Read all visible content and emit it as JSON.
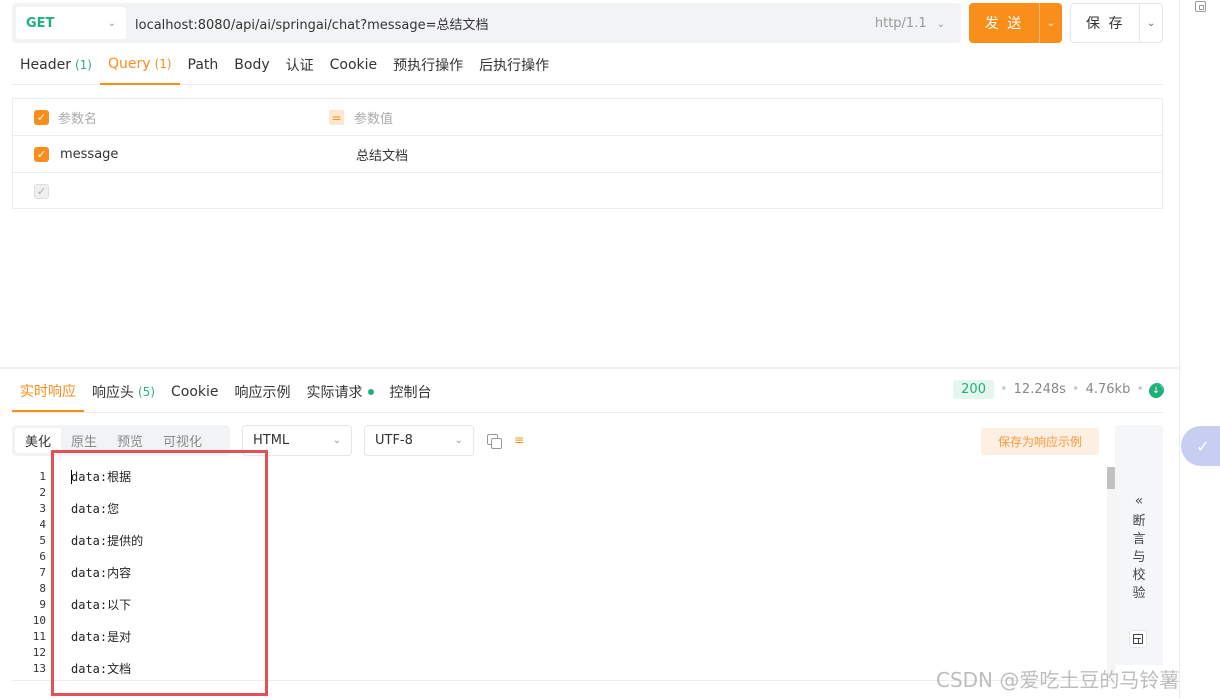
{
  "request": {
    "method": "GET",
    "url": "localhost:8080/api/ai/springai/chat?message=总结文档",
    "protocol": "http/1.1",
    "send_label": "发 送",
    "save_label": "保 存"
  },
  "request_tabs": [
    {
      "label": "Header",
      "count": "(1)"
    },
    {
      "label": "Query",
      "count": "(1)",
      "active": true
    },
    {
      "label": "Path"
    },
    {
      "label": "Body"
    },
    {
      "label": "认证"
    },
    {
      "label": "Cookie"
    },
    {
      "label": "预执行操作"
    },
    {
      "label": "后执行操作"
    }
  ],
  "params": {
    "name_placeholder": "参数名",
    "value_placeholder": "参数值",
    "rows": [
      {
        "name": "message",
        "value": "总结文档",
        "checked": true
      }
    ]
  },
  "response_tabs": [
    {
      "label": "实时响应",
      "active": true
    },
    {
      "label": "响应头",
      "count": "(5)"
    },
    {
      "label": "Cookie"
    },
    {
      "label": "响应示例"
    },
    {
      "label": "实际请求",
      "dot": true
    },
    {
      "label": "控制台"
    }
  ],
  "response_meta": {
    "status": "200",
    "time": "12.248s",
    "size": "4.76kb"
  },
  "view_modes": [
    {
      "label": "美化",
      "active": true
    },
    {
      "label": "原生"
    },
    {
      "label": "预览"
    },
    {
      "label": "可视化"
    }
  ],
  "format_select": "HTML",
  "encoding_select": "UTF-8",
  "save_example_label": "保存为响应示例",
  "code_lines": [
    {
      "n": "1",
      "text": "data:根据"
    },
    {
      "n": "2",
      "text": ""
    },
    {
      "n": "3",
      "text": "data:您"
    },
    {
      "n": "4",
      "text": ""
    },
    {
      "n": "5",
      "text": "data:提供的"
    },
    {
      "n": "6",
      "text": ""
    },
    {
      "n": "7",
      "text": "data:内容"
    },
    {
      "n": "8",
      "text": ""
    },
    {
      "n": "9",
      "text": "data:以下"
    },
    {
      "n": "10",
      "text": ""
    },
    {
      "n": "11",
      "text": "data:是对"
    },
    {
      "n": "12",
      "text": ""
    },
    {
      "n": "13",
      "text": "data:文档"
    }
  ],
  "assert_panel_label": "断言与校验",
  "watermark": "CSDN @爱吃土豆的马铃薯",
  "colors": {
    "accent": "#f98e1b",
    "success": "#1fb17a",
    "highlight_box": "#e05256"
  }
}
